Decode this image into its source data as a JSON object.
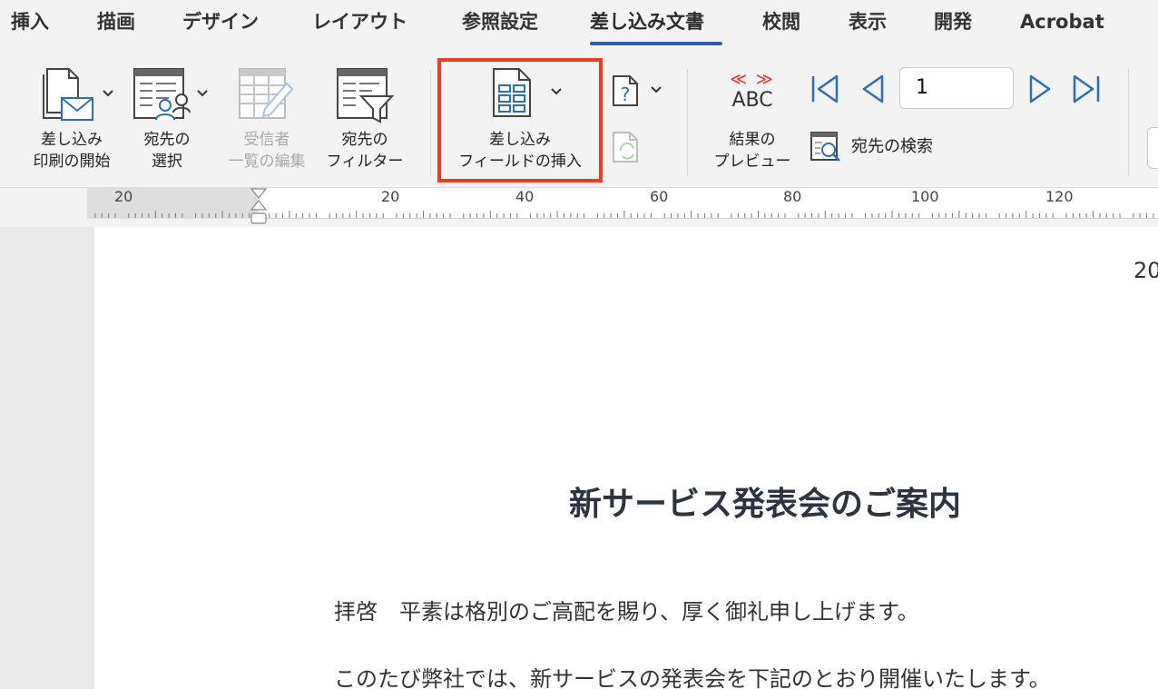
{
  "tabs": [
    {
      "label": "挿入"
    },
    {
      "label": "描画"
    },
    {
      "label": "デザイン"
    },
    {
      "label": "レイアウト"
    },
    {
      "label": "参照設定"
    },
    {
      "label": "差し込み文書",
      "active": true
    },
    {
      "label": "校閲"
    },
    {
      "label": "表示"
    },
    {
      "label": "開発"
    },
    {
      "label": "Acrobat"
    }
  ],
  "ribbon": {
    "start_merge": {
      "line1": "差し込み",
      "line2": "印刷の開始"
    },
    "select_recipients": {
      "line1": "宛先の",
      "line2": "選択"
    },
    "edit_recipients": {
      "line1": "受信者",
      "line2": "一覧の編集",
      "disabled": true
    },
    "filter_recipients": {
      "line1": "宛先の",
      "line2": "フィルター"
    },
    "insert_merge_field": {
      "line1": "差し込み",
      "line2": "フィールドの挿入",
      "highlighted": true
    },
    "preview_results": {
      "glyph_top": "≪ ≫",
      "glyph_bottom": "ABC",
      "line1": "結果の",
      "line2": "プレビュー"
    },
    "record_number": "1",
    "find_recipient": "宛先の検索"
  },
  "ruler": {
    "labels": [
      "20",
      "20",
      "40",
      "60",
      "80",
      "100",
      "120"
    ]
  },
  "document": {
    "date_fragment": "20",
    "title": "新サービス発表会のご案内",
    "line1": "拝啓　平素は格別のご高配を賜り、厚く御礼申し上げます。",
    "line2": "このたび弊社では、新サービスの発表会を下記のとおり開催いたします。"
  },
  "colors": {
    "highlight_border": "#e8401c",
    "active_tab_underline": "#2f5da6",
    "icon_blue": "#2f6db3",
    "preview_red": "#d93b2b"
  }
}
